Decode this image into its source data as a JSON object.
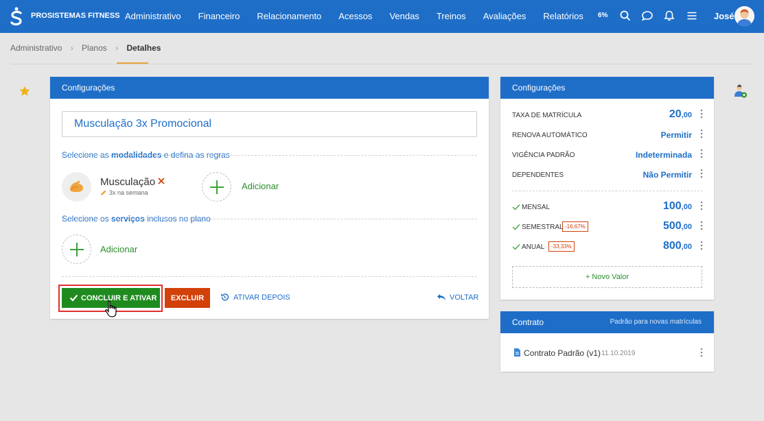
{
  "app": {
    "brand": "PROSISTEMAS FITNESS"
  },
  "nav": {
    "items": [
      "Administrativo",
      "Financeiro",
      "Relacionamento",
      "Acessos",
      "Vendas",
      "Treinos",
      "Avaliações",
      "Relatórios"
    ],
    "progress": "6%",
    "user": "José"
  },
  "breadcrumb": {
    "items": [
      "Administrativo",
      "Planos",
      "Detalhes"
    ]
  },
  "main": {
    "title": "Configurações",
    "plan_name": "Musculação 3x Promocional",
    "modalities_prefix": "Selecione as ",
    "modalities_bold": "modalidades",
    "modalities_suffix": " e defina as regras",
    "modality": {
      "name": "Musculação",
      "rule": "3x na semana"
    },
    "add_label": "Adicionar",
    "services_prefix": "Selecione os ",
    "services_bold": "serviços",
    "services_suffix": " inclusos no plano",
    "services_add_label": "Adicionar",
    "confirm_button": "CONCLUIR E ATIVAR",
    "delete_button": "EXCLUIR",
    "activate_later": "ATIVAR DEPOIS",
    "back": "VOLTAR"
  },
  "config": {
    "title": "Configurações",
    "rows": [
      {
        "label": "TAXA DE MATRÍCULA",
        "value_int": "20",
        "value_dec": ",00"
      },
      {
        "label": "RENOVA AUTOMÁTICO",
        "value": "Permitir"
      },
      {
        "label": "VIGÊNCIA PADRÃO",
        "value": "Indeterminada"
      },
      {
        "label": "DEPENDENTES",
        "value": "Não Permitir"
      }
    ],
    "prices": [
      {
        "label": "MENSAL",
        "discount": "",
        "value_int": "100",
        "value_dec": ",00"
      },
      {
        "label": "SEMESTRAL",
        "discount": "-16,67%",
        "value_int": "500",
        "value_dec": ",00"
      },
      {
        "label": "ANUAL",
        "discount": "-33,33%",
        "value_int": "800",
        "value_dec": ",00"
      }
    ],
    "new_value": "+ Novo Valor"
  },
  "contract": {
    "title": "Contrato",
    "subtitle": "Padrão para novas matrículas",
    "name": "Contrato Padrão (v1)",
    "date": "11.10.2019"
  },
  "colors": {
    "primary": "#1e6ec8",
    "success": "#1f8b1f",
    "danger": "#d2410a",
    "highlight": "#e0302d",
    "accent": "#e8a33d"
  }
}
